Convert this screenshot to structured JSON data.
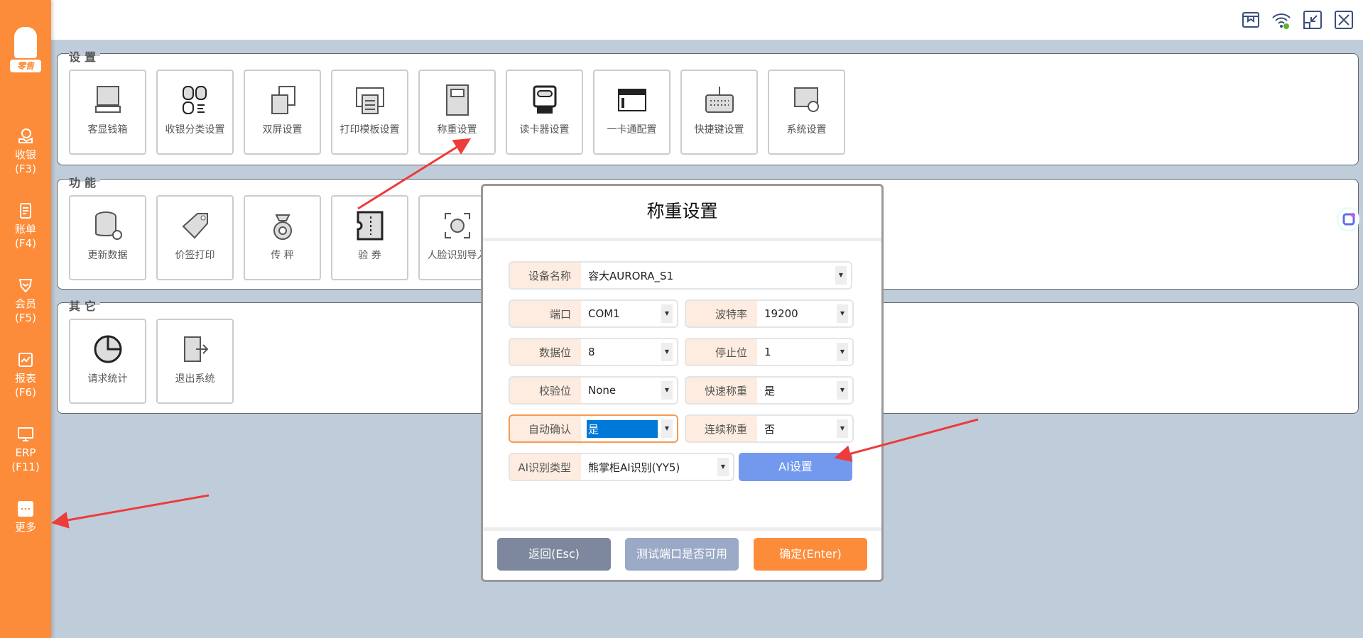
{
  "sidebar": {
    "logo_text": "零售",
    "items": [
      {
        "label": "收银",
        "key": "(F3)",
        "icon": "cashier-icon"
      },
      {
        "label": "账单",
        "key": "(F4)",
        "icon": "bill-icon"
      },
      {
        "label": "会员",
        "key": "(F5)",
        "icon": "member-icon"
      },
      {
        "label": "报表",
        "key": "(F6)",
        "icon": "report-icon"
      },
      {
        "label": "ERP",
        "key": "(F11)",
        "icon": "erp-icon"
      },
      {
        "label": "更多",
        "key": "",
        "icon": "more-icon"
      }
    ]
  },
  "topbar": {
    "icons": [
      "store-icon",
      "wifi-connected-icon",
      "minimize-icon",
      "close-icon"
    ]
  },
  "sections": [
    {
      "title": "设置",
      "tiles": [
        "客显钱箱",
        "收银分类设置",
        "双屏设置",
        "打印模板设置",
        "称重设置",
        "读卡器设置",
        "一卡通配置",
        "快捷键设置",
        "系统设置"
      ]
    },
    {
      "title": "功能",
      "tiles": [
        "更新数据",
        "价签打印",
        "传 秤",
        "验 券",
        "人脸识别导入"
      ]
    },
    {
      "title": "其它",
      "tiles": [
        "请求统计",
        "退出系统"
      ]
    }
  ],
  "dialog": {
    "title": "称重设置",
    "device_name": {
      "label": "设备名称",
      "value": "容大AURORA_S1"
    },
    "port": {
      "label": "端口",
      "value": "COM1"
    },
    "baud": {
      "label": "波特率",
      "value": "19200"
    },
    "databits": {
      "label": "数据位",
      "value": "8"
    },
    "stopbits": {
      "label": "停止位",
      "value": "1"
    },
    "parity": {
      "label": "校验位",
      "value": "None"
    },
    "quick": {
      "label": "快速称重",
      "value": "是"
    },
    "autoconfirm": {
      "label": "自动确认",
      "value": "是"
    },
    "continuous": {
      "label": "连续称重",
      "value": "否"
    },
    "ai_type": {
      "label": "AI识别类型",
      "value": "熊掌柜AI识别(YY5)"
    },
    "ai_button": "AI设置",
    "back": "返回(Esc)",
    "test": "测试端口是否可用",
    "ok": "确定(Enter)"
  },
  "colors": {
    "accent": "#fc8c3a",
    "ai_button": "#7399ee",
    "back": "#7d889e",
    "test": "#9aaac6",
    "ok": "#fc8c3a",
    "arrow": "#ee3b3b"
  }
}
